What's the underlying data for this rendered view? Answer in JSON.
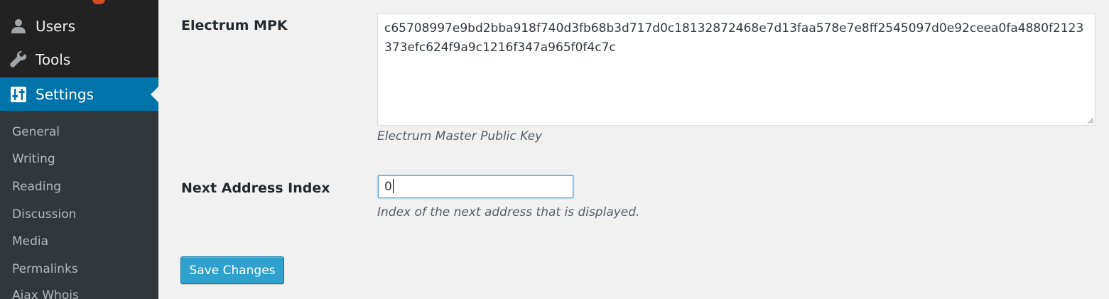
{
  "sidebar": {
    "menu": [
      {
        "key": "users",
        "label": "Users",
        "icon": "users-icon"
      },
      {
        "key": "tools",
        "label": "Tools",
        "icon": "wrench-icon"
      },
      {
        "key": "settings",
        "label": "Settings",
        "icon": "settings-sliders-icon",
        "active": true
      }
    ],
    "submenu": [
      "General",
      "Writing",
      "Reading",
      "Discussion",
      "Media",
      "Permalinks",
      "Ajax Whois"
    ]
  },
  "form": {
    "mpk": {
      "label": "Electrum MPK",
      "value": "c65708997e9bd2bba918f740d3fb68b3d717d0c18132872468e7d13faa578e7e8ff2545097d0e92ceea0fa4880f2123373efc624f9a9c1216f347a965f0f4c7c",
      "description": "Electrum Master Public Key"
    },
    "next_index": {
      "label": "Next Address Index",
      "value": "0",
      "description": "Index of the next address that is displayed."
    },
    "save_label": "Save Changes"
  },
  "colors": {
    "sidebar_bg": "#222222",
    "submenu_bg": "#32373c",
    "active_menu_bg": "#0073aa",
    "button_bg": "#2ea2cc",
    "content_bg": "#f1f1f1"
  }
}
